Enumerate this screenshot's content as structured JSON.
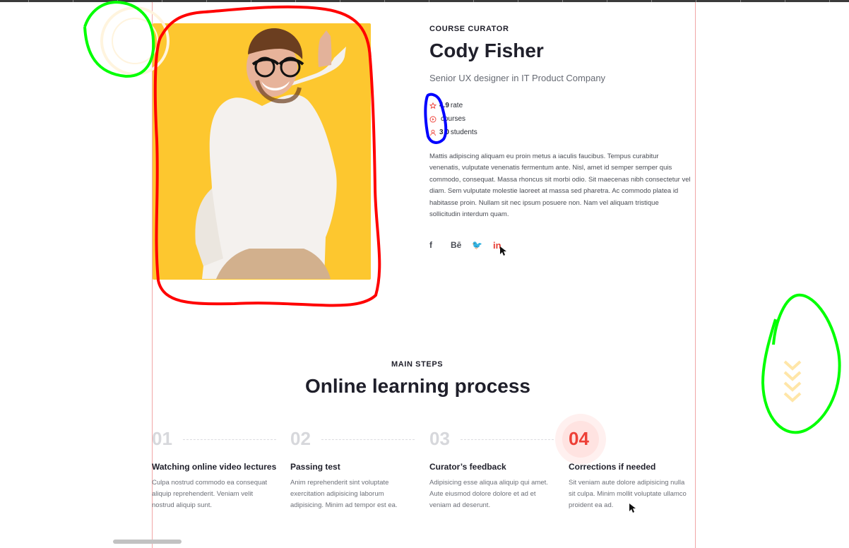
{
  "curator": {
    "eyebrow": "COURSE CURATOR",
    "name": "Cody Fisher",
    "role": "Senior UX designer in IT Product Company",
    "stats": [
      {
        "icon": "star-icon",
        "value": "4.9",
        "label": "rate"
      },
      {
        "icon": "play-icon",
        "value": "",
        "label": "courses"
      },
      {
        "icon": "user-icon",
        "value": "3 0",
        "label": "students"
      }
    ],
    "bio": "Mattis adipiscing aliquam eu proin metus a iaculis faucibus. Tempus curabitur venenatis, vulputate venenatis fermentum ante. Nisl, amet id semper semper quis commodo, consequat. Massa rhoncus sit morbi odio. Sit maecenas nibh consectetur vel diam. Sem vulputate molestie laoreet at massa sed pharetra. Ac commodo platea id habitasse proin. Nullam sit nec ipsum posuere non. Nam vel aliquam tristique sollicitudin interdum quam.",
    "social": [
      {
        "name": "facebook-icon",
        "label": "f"
      },
      {
        "name": "behance-icon",
        "label": "Bē"
      },
      {
        "name": "twitter-icon",
        "label": "🐦"
      },
      {
        "name": "linkedin-icon",
        "label": "in"
      }
    ]
  },
  "process": {
    "eyebrow": "MAIN STEPS",
    "title": "Online learning process",
    "steps": [
      {
        "number": "01",
        "title": "Watching online video lectures",
        "text": "Culpa nostrud commodo ea consequat aliquip reprehenderit. Veniam velit nostrud aliquip sunt."
      },
      {
        "number": "02",
        "title": "Passing test",
        "text": "Anim reprehenderit sint voluptate exercitation adipisicing laborum adipisicing. Minim ad tempor est ea."
      },
      {
        "number": "03",
        "title": "Curator’s feedback",
        "text": "Adipisicing esse aliqua aliquip qui amet. Aute eiusmod dolore dolore et ad et veniam ad deserunt."
      },
      {
        "number": "04",
        "title": "Corrections if needed",
        "text": "Sit veniam aute dolore adipisicing nulla sit culpa. Minim mollit voluptate ullamco proident ea ad."
      }
    ]
  },
  "colors": {
    "accent": "#ed4037",
    "photo_background": "#fdc72f",
    "annotation_red": "#ff0000",
    "annotation_green": "#00ff00",
    "annotation_blue": "#0000ff"
  }
}
